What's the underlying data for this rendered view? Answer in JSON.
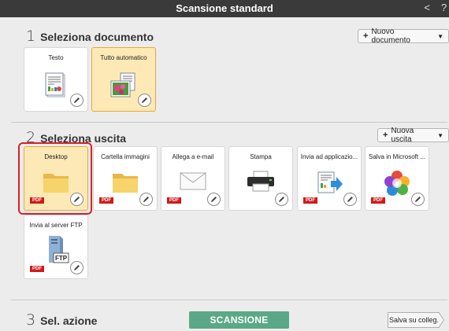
{
  "window": {
    "title": "Scansione standard",
    "back_glyph": "<",
    "help_glyph": "?"
  },
  "section1": {
    "number": "1",
    "title": "Seleziona documento",
    "add_button": "Nuovo documento",
    "cards": [
      {
        "label": "Testo",
        "icon": "text-document-icon",
        "selected": false
      },
      {
        "label": "Tutto automatico",
        "icon": "photo-document-icon",
        "selected": true
      }
    ]
  },
  "section2": {
    "number": "2",
    "title": "Seleziona uscita",
    "add_button": "Nuova uscita",
    "cards": [
      {
        "label": "Desktop",
        "icon": "folder-icon",
        "pdf": "PDF",
        "selected": true
      },
      {
        "label": "Cartella immagini",
        "icon": "folder-icon",
        "pdf": "PDF",
        "selected": false
      },
      {
        "label": "Allega a e-mail",
        "icon": "email-icon",
        "pdf": "PDF",
        "selected": false
      },
      {
        "label": "Stampa",
        "icon": "printer-icon",
        "pdf": "",
        "selected": false
      },
      {
        "label": "Invia ad applicazio...",
        "icon": "send-to-app-icon",
        "pdf": "PDF",
        "selected": false
      },
      {
        "label": "Salva in Microsoft ...",
        "icon": "microsoft-app-icon",
        "pdf": "PDF",
        "selected": false
      },
      {
        "label": "Invia al server FTP",
        "icon": "ftp-server-icon",
        "pdf": "PDF",
        "ftp_badge": "FTP",
        "selected": false
      }
    ]
  },
  "section3": {
    "number": "3",
    "title": "Sel. azione",
    "scan_button": "SCANSIONE",
    "save_button": "Salva su colleg."
  },
  "colors": {
    "titlebar": "#3a3a3a",
    "selected_card": "#fde9b6",
    "scan_button": "#5aa886",
    "highlight": "#d8222a",
    "pdf_badge": "#d01a1a"
  }
}
